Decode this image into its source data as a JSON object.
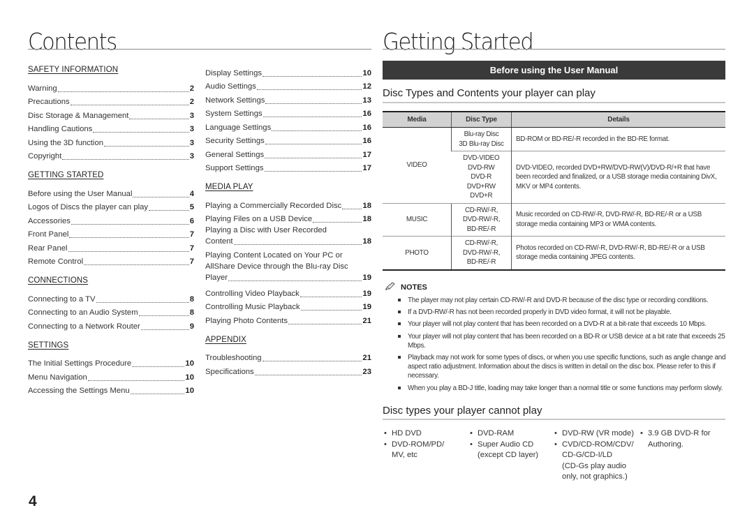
{
  "left_page": {
    "title": "Contents",
    "columns": [
      {
        "sections": [
          {
            "heading": "SAFETY INFORMATION",
            "entries": [
              {
                "text": "Warning",
                "page": "2"
              },
              {
                "text": "Precautions",
                "page": "2"
              },
              {
                "text": "Disc Storage & Management",
                "page": "3"
              },
              {
                "text": "Handling Cautions",
                "page": "3"
              },
              {
                "text": "Using the 3D function",
                "page": "3"
              },
              {
                "text": "Copyright",
                "page": "3"
              }
            ]
          },
          {
            "heading": "GETTING STARTED",
            "entries": [
              {
                "text": "Before using the User Manual",
                "page": "4"
              },
              {
                "text": "Logos of Discs the player can play",
                "page": "5"
              },
              {
                "text": "Accessories",
                "page": "6"
              },
              {
                "text": "Front Panel",
                "page": "7"
              },
              {
                "text": "Rear Panel",
                "page": "7"
              },
              {
                "text": "Remote Control",
                "page": "7"
              }
            ]
          },
          {
            "heading": "CONNECTIONS",
            "entries": [
              {
                "text": "Connecting to a TV",
                "page": "8"
              },
              {
                "text": "Connecting to an Audio System",
                "page": "8"
              },
              {
                "text": "Connecting to a Network Router",
                "page": "9"
              }
            ]
          },
          {
            "heading": "SETTINGS",
            "entries": [
              {
                "text": "The Initial Settings Procedure",
                "page": "10"
              },
              {
                "text": "Menu Navigation",
                "page": "10"
              },
              {
                "text": "Accessing the Settings Menu",
                "page": "10"
              }
            ]
          }
        ]
      },
      {
        "sections": [
          {
            "heading": "",
            "entries": [
              {
                "text": "Display Settings",
                "page": "10"
              },
              {
                "text": "Audio Settings",
                "page": "12"
              },
              {
                "text": "Network Settings",
                "page": "13"
              },
              {
                "text": "System Settings",
                "page": "16"
              },
              {
                "text": "Language Settings",
                "page": "16"
              },
              {
                "text": "Security Settings",
                "page": "16"
              },
              {
                "text": "General Settings",
                "page": "17"
              },
              {
                "text": "Support Settings",
                "page": "17"
              }
            ]
          },
          {
            "heading": "MEDIA PLAY",
            "entries": [
              {
                "text": "Playing a Commercially Recorded Disc",
                "page": "18"
              },
              {
                "text": "Playing Files on a USB Device",
                "page": "18"
              },
              {
                "pre": [
                  "Playing a Disc with User Recorded"
                ],
                "text": "Content",
                "page": "18"
              },
              {
                "pre": [
                  "Playing Content Located on Your PC or",
                  "AllShare Device through the Blu-ray Disc"
                ],
                "text": "Player",
                "page": "19"
              },
              {
                "text": "Controlling Video Playback",
                "page": "19"
              },
              {
                "text": "Controlling Music Playback",
                "page": "19"
              },
              {
                "text": "Playing Photo Contents",
                "page": "21"
              }
            ]
          },
          {
            "heading": "APPENDIX",
            "entries": [
              {
                "text": "Troubleshooting",
                "page": "21"
              },
              {
                "text": "Specifications",
                "page": "23"
              }
            ]
          }
        ]
      }
    ],
    "page_number": "4"
  },
  "right_page": {
    "title": "Getting Started",
    "bar_label": "Before using the User Manual",
    "can_play": {
      "title": "Disc Types and Contents your player can play",
      "headers": [
        "Media",
        "Disc Type",
        "Details"
      ],
      "groups": [
        {
          "media": "VIDEO",
          "rows": [
            {
              "disc_types": [
                "Blu-ray Disc",
                "3D Blu-ray Disc"
              ],
              "details": "BD-ROM or BD-RE/-R recorded in the BD-RE format."
            },
            {
              "disc_types": [
                "DVD-VIDEO",
                "DVD-RW",
                "DVD-R",
                "DVD+RW",
                "DVD+R"
              ],
              "details": "DVD-VIDEO, recorded DVD+RW/DVD-RW(V)/DVD-R/+R that have been recorded and finalized, or a USB storage media containing DivX, MKV or MP4 contents."
            }
          ]
        },
        {
          "media": "MUSIC",
          "rows": [
            {
              "disc_types": [
                "CD-RW/-R,",
                "DVD-RW/-R,",
                "BD-RE/-R"
              ],
              "details": "Music recorded on CD-RW/-R, DVD-RW/-R, BD-RE/-R or a USB storage media containing MP3 or WMA contents."
            }
          ]
        },
        {
          "media": "PHOTO",
          "rows": [
            {
              "disc_types": [
                "CD-RW/-R,",
                "DVD-RW/-R,",
                "BD-RE/-R"
              ],
              "details": "Photos recorded on CD-RW/-R, DVD-RW/-R, BD-RE/-R or a USB storage media containing JPEG contents."
            }
          ]
        }
      ]
    },
    "notes": {
      "icon": "pencil-icon",
      "heading": "NOTES",
      "items": [
        "The player may not play certain CD-RW/-R and DVD-R because of the disc type or recording conditions.",
        "If a DVD-RW/-R has not been recorded properly in DVD video format, it will not be playable.",
        "Your player will not play content that has been recorded on a DVD-R at a bit-rate that exceeds 10 Mbps.",
        "Your player will not play content that has been recorded on a BD-R or USB device at a bit rate that exceeds 25 Mbps.",
        "Playback may not work for some types of discs, or when you use specific functions, such as angle change and aspect ratio adjustment. Information about the discs is written in detail on the disc box. Please refer to this if necessary.",
        "When you play a BD-J title, loading may take longer than a normal title or some functions may perform slowly."
      ]
    },
    "cannot_play": {
      "title": "Disc types your player cannot play",
      "columns": [
        [
          {
            "lines": [
              "HD DVD"
            ]
          },
          {
            "lines": [
              "DVD-ROM/PD/",
              "MV, etc"
            ]
          }
        ],
        [
          {
            "lines": [
              "DVD-RAM"
            ]
          },
          {
            "lines": [
              "Super Audio CD",
              "(except CD layer)"
            ]
          }
        ],
        [
          {
            "lines": [
              "DVD-RW (VR mode)"
            ]
          },
          {
            "lines": [
              "CVD/CD-ROM/CDV/",
              "CD-G/CD-I/LD",
              "(CD-Gs play audio",
              "only, not graphics.)"
            ]
          }
        ],
        [
          {
            "lines": [
              "3.9 GB DVD-R for",
              "Authoring."
            ]
          }
        ]
      ]
    }
  }
}
